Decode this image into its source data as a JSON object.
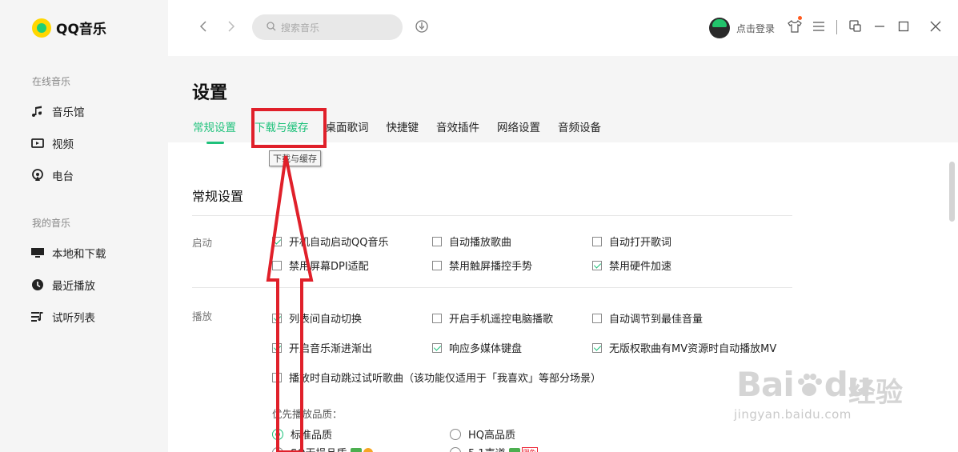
{
  "app": {
    "logo_text": "QQ音乐"
  },
  "sidebar": {
    "section1": "在线音乐",
    "items1": [
      {
        "label": "音乐馆",
        "icon": "music-note-icon"
      },
      {
        "label": "视频",
        "icon": "video-icon"
      },
      {
        "label": "电台",
        "icon": "radio-icon"
      }
    ],
    "section2": "我的音乐",
    "items2": [
      {
        "label": "本地和下载",
        "icon": "monitor-icon"
      },
      {
        "label": "最近播放",
        "icon": "clock-icon"
      },
      {
        "label": "试听列表",
        "icon": "playlist-icon"
      }
    ]
  },
  "topbar": {
    "search_placeholder": "搜索音乐",
    "login_label": "点击登录"
  },
  "header": {
    "title": "设置",
    "tabs": [
      "常规设置",
      "下载与缓存",
      "桌面歌词",
      "快捷键",
      "音效插件",
      "网络设置",
      "音频设备"
    ],
    "active_tab": 0,
    "tooltip": "下载与缓存"
  },
  "content": {
    "section_title": "常规设置",
    "startup": {
      "label": "启动",
      "options": [
        {
          "label": "开机自动启动QQ音乐",
          "checked": true
        },
        {
          "label": "自动播放歌曲",
          "checked": false
        },
        {
          "label": "自动打开歌词",
          "checked": false
        },
        {
          "label": "禁用屏幕DPI适配",
          "checked": false
        },
        {
          "label": "禁用触屏播控手势",
          "checked": false
        },
        {
          "label": "禁用硬件加速",
          "checked": true
        }
      ]
    },
    "playback": {
      "label": "播放",
      "options": [
        {
          "label": "列表间自动切换",
          "checked": true
        },
        {
          "label": "开启手机遥控电脑播歌",
          "checked": false
        },
        {
          "label": "自动调节到最佳音量",
          "checked": false
        },
        {
          "label": "开启音乐渐进渐出",
          "checked": true
        },
        {
          "label": "响应多媒体键盘",
          "checked": true
        },
        {
          "label": "无版权歌曲有MV资源时自动播放MV",
          "checked": true
        },
        {
          "label": "播放时自动跳过试听歌曲（该功能仅适用于「我喜欢」等部分场景）",
          "checked": false
        }
      ],
      "quality_label": "优先播放品质：",
      "qualities": [
        {
          "label": "标准品质",
          "selected": true
        },
        {
          "label": "HQ高品质",
          "selected": false
        },
        {
          "label": "SQ无损品质",
          "selected": false
        },
        {
          "label": "5.1声道",
          "selected": false
        }
      ],
      "badge_text": "限免"
    }
  },
  "watermark": {
    "brand": "Bai",
    "brand2": "du",
    "cn": "经验",
    "url": "jingyan.baidu.com"
  },
  "colors": {
    "accent": "#1ec17b",
    "annotation": "#e0202a"
  }
}
